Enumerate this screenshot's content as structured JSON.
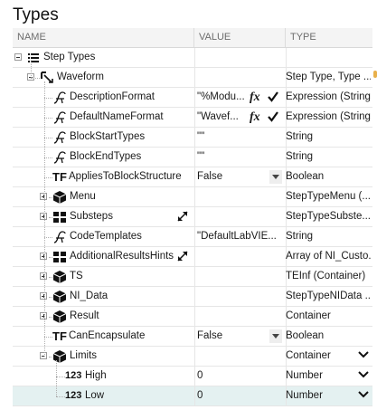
{
  "panel": {
    "title": "Types"
  },
  "columns": {
    "name": "NAME",
    "value": "VALUE",
    "type": "TYPE"
  },
  "rows": [
    {
      "id": "step-types",
      "name": "Step Types",
      "value": "",
      "type": "",
      "icon": "list-icon",
      "expander": "minus",
      "level": 0
    },
    {
      "id": "waveform",
      "name": "Waveform",
      "value": "",
      "type": "Step Type, Type ...",
      "icon": "step-type-icon",
      "expander": "minus",
      "level": 1
    },
    {
      "id": "description-format",
      "name": "DescriptionFormat",
      "value": "\"%Modu...",
      "type": "Expression (String)",
      "icon": "string-icon",
      "fx": "fx",
      "check": true,
      "level": 2
    },
    {
      "id": "default-name-format",
      "name": "DefaultNameFormat",
      "value": "\"Wavef...",
      "type": "Expression (String)",
      "icon": "string-icon",
      "fx": "fx",
      "check": true,
      "level": 2
    },
    {
      "id": "block-start-types",
      "name": "BlockStartTypes",
      "value": "\"\"",
      "type": "String",
      "icon": "string-icon",
      "level": 2
    },
    {
      "id": "block-end-types",
      "name": "BlockEndTypes",
      "value": "\"\"",
      "type": "String",
      "icon": "string-icon",
      "level": 2
    },
    {
      "id": "applies-to-block-structure",
      "name": "AppliesToBlockStructure",
      "value": "False",
      "type": "Boolean",
      "icon": "boolean-icon",
      "glyph": "TF",
      "dropdown": true,
      "level": 2
    },
    {
      "id": "menu",
      "name": "Menu",
      "value": "",
      "type": "StepTypeMenu (...",
      "icon": "container-icon",
      "expander": "plus",
      "level": 2
    },
    {
      "id": "substeps",
      "name": "Substeps",
      "value": "",
      "type": "StepTypeSubste...",
      "icon": "array-icon",
      "expander": "plus",
      "resize": true,
      "level": 2
    },
    {
      "id": "code-templates",
      "name": "CodeTemplates",
      "value": "\"DefaultLabVIE...",
      "type": "String",
      "icon": "string-icon",
      "level": 2
    },
    {
      "id": "additional-results-hints",
      "name": "AdditionalResultsHints",
      "value": "",
      "type": "Array of NI_Custo...",
      "icon": "array-icon",
      "expander": "plus",
      "resize": true,
      "level": 2
    },
    {
      "id": "ts",
      "name": "TS",
      "value": "",
      "type": "TEInf (Container)",
      "icon": "container-icon",
      "expander": "plus",
      "level": 2
    },
    {
      "id": "ni-data",
      "name": "NI_Data",
      "value": "",
      "type": "StepTypeNIData ...",
      "icon": "container-icon",
      "expander": "plus",
      "level": 2
    },
    {
      "id": "result",
      "name": "Result",
      "value": "",
      "type": "Container",
      "icon": "container-icon",
      "expander": "plus",
      "level": 2
    },
    {
      "id": "can-encapsulate",
      "name": "CanEncapsulate",
      "value": "False",
      "type": "Boolean",
      "icon": "boolean-icon",
      "glyph": "TF",
      "dropdown": true,
      "level": 2
    },
    {
      "id": "limits",
      "name": "Limits",
      "value": "",
      "type": "Container",
      "icon": "container-icon",
      "expander": "minus",
      "typeChevron": true,
      "level": 2
    },
    {
      "id": "high",
      "name": "High",
      "value": "0",
      "type": "Number",
      "icon": "number-icon",
      "glyph": "123",
      "typeChevron": true,
      "level": 3
    },
    {
      "id": "low",
      "name": "Low",
      "value": "0",
      "type": "Number",
      "icon": "number-icon",
      "glyph": "123",
      "typeChevron": true,
      "level": 3,
      "selected": true
    }
  ]
}
